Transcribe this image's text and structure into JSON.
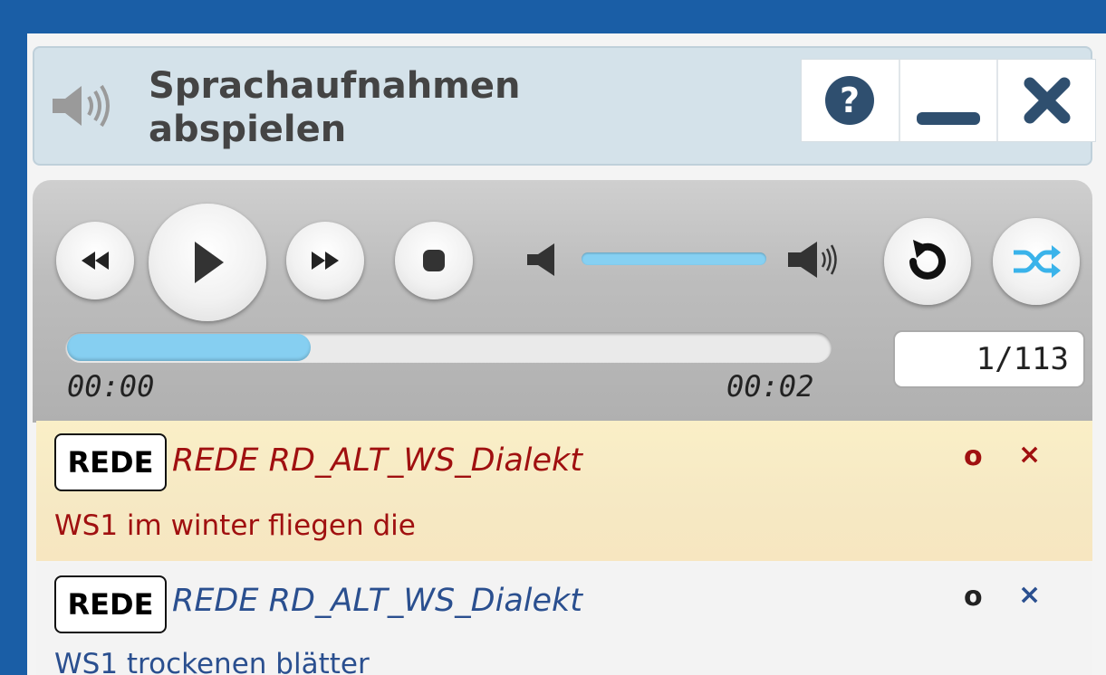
{
  "header": {
    "title": "Sprachaufnahmen abspielen",
    "buttons": [
      "help-icon",
      "minimize-icon",
      "close-icon"
    ]
  },
  "player": {
    "controls": [
      "rewind",
      "play",
      "fast-forward",
      "stop",
      "volume-mute",
      "volume-up",
      "repeat",
      "shuffle"
    ],
    "time_start": "00:00",
    "time_end": "00:02",
    "progress_fraction": 0.32,
    "counter": "1/113",
    "accent": "#86cff1"
  },
  "playlist": [
    {
      "tag": "REDE",
      "title": "REDE RD_ALT_WS_Dialekt",
      "subtitle": "WS1 im winter fliegen die",
      "ctl_o": "o",
      "ctl_x": "×",
      "color": "#a01010"
    },
    {
      "tag": "REDE",
      "title": "REDE RD_ALT_WS_Dialekt",
      "subtitle": "WS1 trockenen blätter",
      "ctl_o": "o",
      "ctl_x": "×",
      "color": "#2a4f8f"
    }
  ]
}
